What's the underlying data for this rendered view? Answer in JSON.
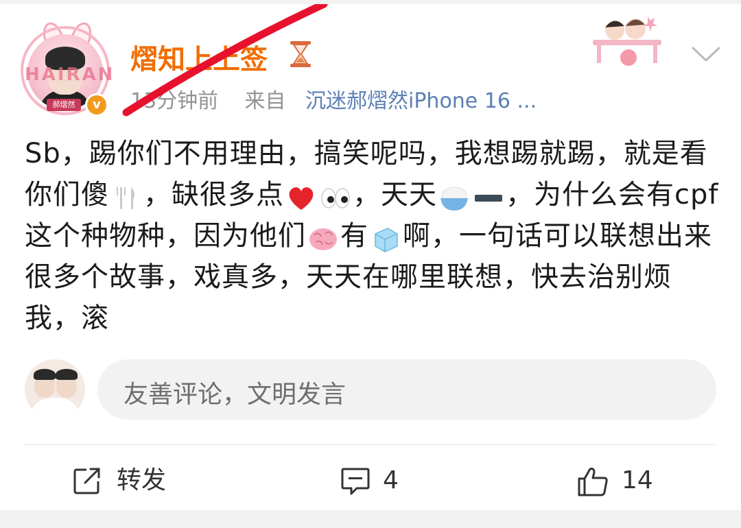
{
  "post": {
    "username": "熠知上上签",
    "username_suffix_icon": "hourglass-icon",
    "time": "13分钟前",
    "from_label": "来自",
    "source": "沉迷郝熠然iPhone 16 ...",
    "avatar_badge": "郝熠然",
    "avatar_frame_text": "HAIRAN",
    "text_parts": [
      "Sb，踢你们不用理由，搞笑呢吗，我想踢就踢，就是看你们傻",
      "，缺很多点",
      "，天天",
      "，为什么会有cpf这个种物种，因为他们",
      "有",
      "啊，一句话可以联想出来很多个故事，戏真多，天天在哪里联想，快去治别烦我，滚"
    ],
    "emoji": [
      "fork-knife-icon",
      "red-heart-icon",
      "eyes-icon",
      "rice-bowl-icon",
      "minus-icon",
      "brain-icon",
      "ice-cube-icon"
    ]
  },
  "comment": {
    "placeholder": "友善评论，文明发言"
  },
  "actions": {
    "repost_label": "转发",
    "comment_count": "4",
    "like_count": "14"
  },
  "colors": {
    "username": "#f26d00",
    "source_link": "#5b7fb4",
    "meta": "#939393",
    "strike": "#e8112d",
    "verified_badge": "#f29a1e"
  }
}
